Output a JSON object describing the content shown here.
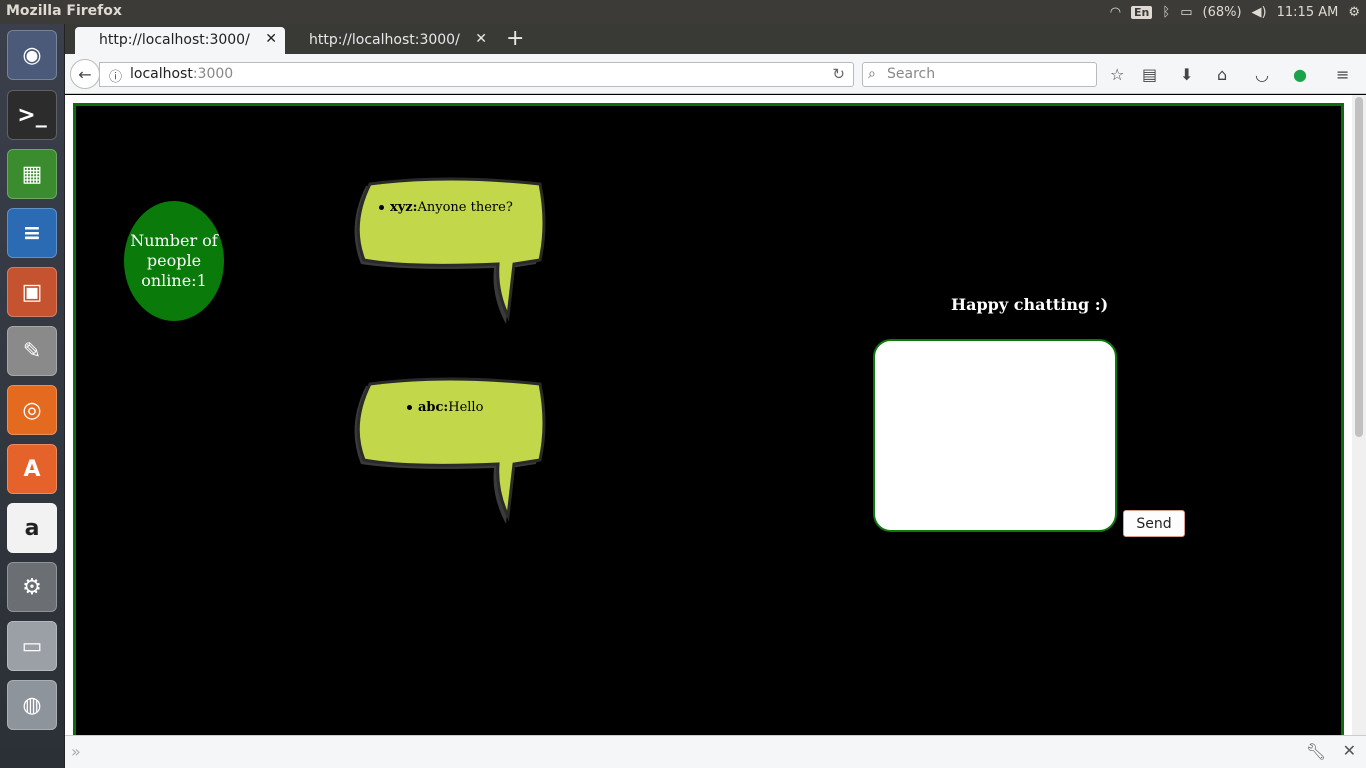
{
  "system": {
    "app_title": "Mozilla Firefox",
    "keyboard": "En",
    "battery": "(68%)",
    "time": "11:15 AM"
  },
  "launcher": {
    "items": [
      {
        "name": "ubuntu-dash-icon",
        "glyph": "◉",
        "color": "#4a5a78"
      },
      {
        "name": "terminal-icon",
        "glyph": ">_",
        "color": "#2c2c2c"
      },
      {
        "name": "spreadsheet-icon",
        "glyph": "▦",
        "color": "#3b8b2f"
      },
      {
        "name": "writer-icon",
        "glyph": "≡",
        "color": "#2a6bb3"
      },
      {
        "name": "impress-icon",
        "glyph": "▣",
        "color": "#c5532f"
      },
      {
        "name": "text-editor-icon",
        "glyph": "✎",
        "color": "#8a8a8a"
      },
      {
        "name": "firefox-icon",
        "glyph": "◎",
        "color": "#e36a1f"
      },
      {
        "name": "software-center-icon",
        "glyph": "A",
        "color": "#e5622a"
      },
      {
        "name": "amazon-icon",
        "glyph": "a",
        "color": "#f2f2f2"
      },
      {
        "name": "system-settings-icon",
        "glyph": "⚙",
        "color": "#6b6f74"
      },
      {
        "name": "drive-icon",
        "glyph": "▭",
        "color": "#9aa0a6"
      },
      {
        "name": "dvd-icon",
        "glyph": "◍",
        "color": "#8d949b"
      }
    ]
  },
  "tabs": [
    {
      "label": "http://localhost:3000/",
      "close": "✕"
    },
    {
      "label": "http://localhost:3000/",
      "close": "✕"
    }
  ],
  "nav": {
    "url_host": "localhost",
    "url_port": ":3000",
    "search_placeholder": "Search"
  },
  "page": {
    "online_text": "Number of people online:1",
    "messages": [
      {
        "user": "xyz:",
        "text": "Anyone there?"
      },
      {
        "user": "abc:",
        "text": "Hello"
      }
    ],
    "chat_heading": "Happy chatting :)",
    "chat_input_value": "",
    "send_label": "Send"
  },
  "colors": {
    "page_background": "#000000",
    "frame_border": "#0b6e0b",
    "online_badge": "#0a7a0a",
    "bubble_fill": "#c2d84a"
  }
}
